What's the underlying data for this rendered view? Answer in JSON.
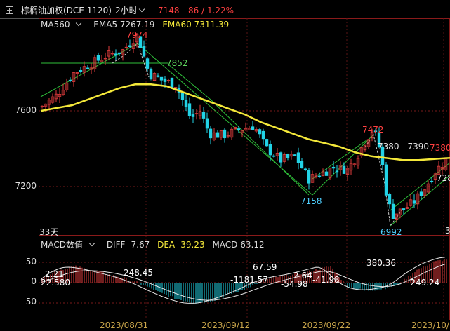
{
  "header": {
    "symbol_name": "棕榈油加权(DCE 1120)",
    "period": "2小时",
    "last_price": "7148",
    "change": "86 / 1.22%"
  },
  "main_legend": {
    "ma_selector": "MA560",
    "ema5": "EMA5 7267.19",
    "ema60": "EMA60 7311.39"
  },
  "macd_legend": {
    "title": "MACD数值",
    "diff": "DIFF -7.67",
    "dea": "DEA -39.23",
    "macd": "MACD 63.12"
  },
  "price_axis": [
    "7600",
    "7200"
  ],
  "macd_axis": [
    "50",
    "0",
    "-50"
  ],
  "price_labels": {
    "high": "7974",
    "trend_level": "7852",
    "peak2": "7472",
    "low1": "7158",
    "low2": "6992",
    "range": "7380 - 7390",
    "right_level": "7380",
    "right_cut": "728",
    "days": "33天"
  },
  "macd_labels": {
    "a": "2.21",
    "b": "22.580",
    "c": "248.45",
    "d": "67.59",
    "e": "-1181.57",
    "f": "2.64",
    "g": "-54.98",
    "h": "-41.98",
    "i": "380.36",
    "j": "-249.24",
    "k": "3"
  },
  "date_axis": [
    "2023/08/31",
    "2023/09/12",
    "2023/09/22",
    "2023/10/"
  ],
  "chart_data": {
    "type": "candlestick",
    "ylim": [
      6900,
      8050
    ],
    "ema60": [
      7560,
      7575,
      7590,
      7620,
      7650,
      7680,
      7700,
      7700,
      7690,
      7660,
      7630,
      7600,
      7570,
      7540,
      7500,
      7470,
      7440,
      7410,
      7390,
      7370,
      7340,
      7320,
      7310,
      7300,
      7300,
      7305,
      7311
    ],
    "macd_hist_approx": [
      10,
      30,
      40,
      30,
      20,
      10,
      -5,
      -25,
      -40,
      -50,
      -45,
      -30,
      -15,
      5,
      15,
      20,
      30,
      40,
      -10,
      -20,
      -15,
      -5,
      30,
      50,
      60
    ]
  },
  "colors": {
    "up": "#e03c3c",
    "down": "#22d3e6",
    "ema": "#f4e83a",
    "trend": "#2fbf3a",
    "accent_red": "#ff4040",
    "label_cyan": "#4fd0ff",
    "label_green": "#5ed45e",
    "date": "#c9a54a"
  }
}
